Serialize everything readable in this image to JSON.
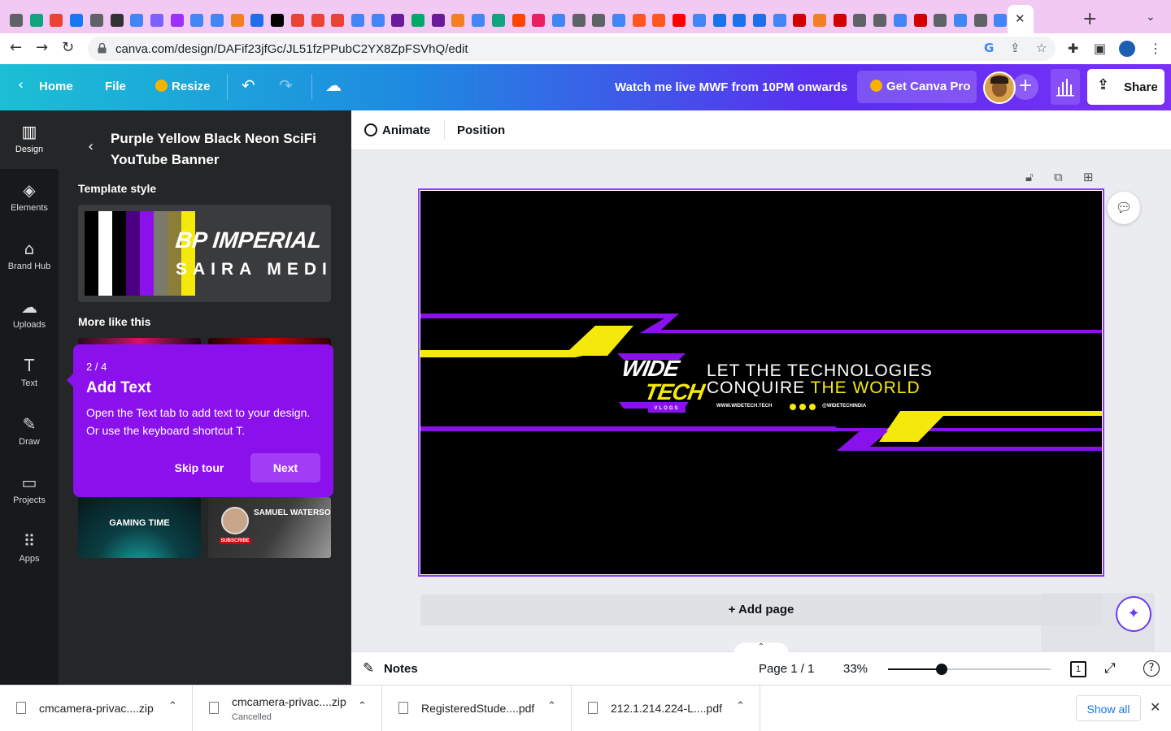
{
  "browser": {
    "url": "canva.com/design/DAFif23jfGc/JL51fzPPubC2YX8ZpFSVhQ/edit",
    "tab_close_icon": "close-icon",
    "new_tab_icon": "plus-icon"
  },
  "header": {
    "home_label": "Home",
    "file_label": "File",
    "resize_label": "Resize",
    "title": "Watch me live MWF from 10PM onwards",
    "get_pro_label": "Get Canva Pro",
    "share_label": "Share",
    "gradient_start": "#1bbfd4",
    "gradient_end": "#7b2ff7"
  },
  "rail": {
    "items": [
      {
        "label": "Design",
        "icon": "design-icon"
      },
      {
        "label": "Elements",
        "icon": "elements-icon"
      },
      {
        "label": "Brand Hub",
        "icon": "brand-hub-icon"
      },
      {
        "label": "Uploads",
        "icon": "upload-icon"
      },
      {
        "label": "Text",
        "icon": "text-icon"
      },
      {
        "label": "Draw",
        "icon": "draw-icon"
      },
      {
        "label": "Projects",
        "icon": "folder-icon"
      },
      {
        "label": "Apps",
        "icon": "apps-grid-icon"
      }
    ]
  },
  "panel": {
    "template_title": "Purple Yellow Black Neon SciFi YouTube Banner",
    "template_style_heading": "Template style",
    "font_primary": "BP IMPERIAL",
    "font_secondary": "SAIRA MEDI",
    "swatches": [
      "#000000",
      "#ffffff",
      "#000000",
      "#4b0082",
      "#8b11ec",
      "#7a7a6a",
      "#8b7d3a",
      "#f5e90b"
    ],
    "more_like_this_heading": "More like this",
    "thumb_gaming_title": "GAMING TIME",
    "thumb_samuel_title": "SAMUEL WATERSON",
    "thumb_samuel_subscribe": "SUBSCRIBE"
  },
  "tour": {
    "step": "2 / 4",
    "title": "Add Text",
    "body": "Open the Text tab to add text to your design. Or use the keyboard shortcut T.",
    "skip_label": "Skip tour",
    "next_label": "Next",
    "color": "#8b11ec"
  },
  "editor": {
    "animate_label": "Animate",
    "position_label": "Position",
    "add_page_label": "+ Add page"
  },
  "banner": {
    "line1": "LET THE TECHNOLOGIES",
    "line2_white": "CONQUIRE ",
    "line2_yellow": "THE WORLD",
    "website": "WWW.WIDETECH.TECH",
    "handle": "@WIDETECHINDIA",
    "logo_top": "WIDE",
    "logo_bottom": "TECH",
    "logo_sub": "VLOGS",
    "accent_purple": "#8b11ec",
    "accent_yellow": "#f5e90b"
  },
  "footer": {
    "notes_label": "Notes",
    "page_label": "Page 1 / 1",
    "zoom_label": "33%",
    "zoom_fraction": 0.33,
    "page_count": "1"
  },
  "downloads": [
    {
      "name": "cmcamera-privac....zip",
      "status": ""
    },
    {
      "name": "cmcamera-privac....zip",
      "status": "Cancelled"
    },
    {
      "name": "RegisteredStude....pdf",
      "status": ""
    },
    {
      "name": "212.1.214.224-L....pdf",
      "status": ""
    }
  ],
  "shelf": {
    "show_all_label": "Show all"
  }
}
